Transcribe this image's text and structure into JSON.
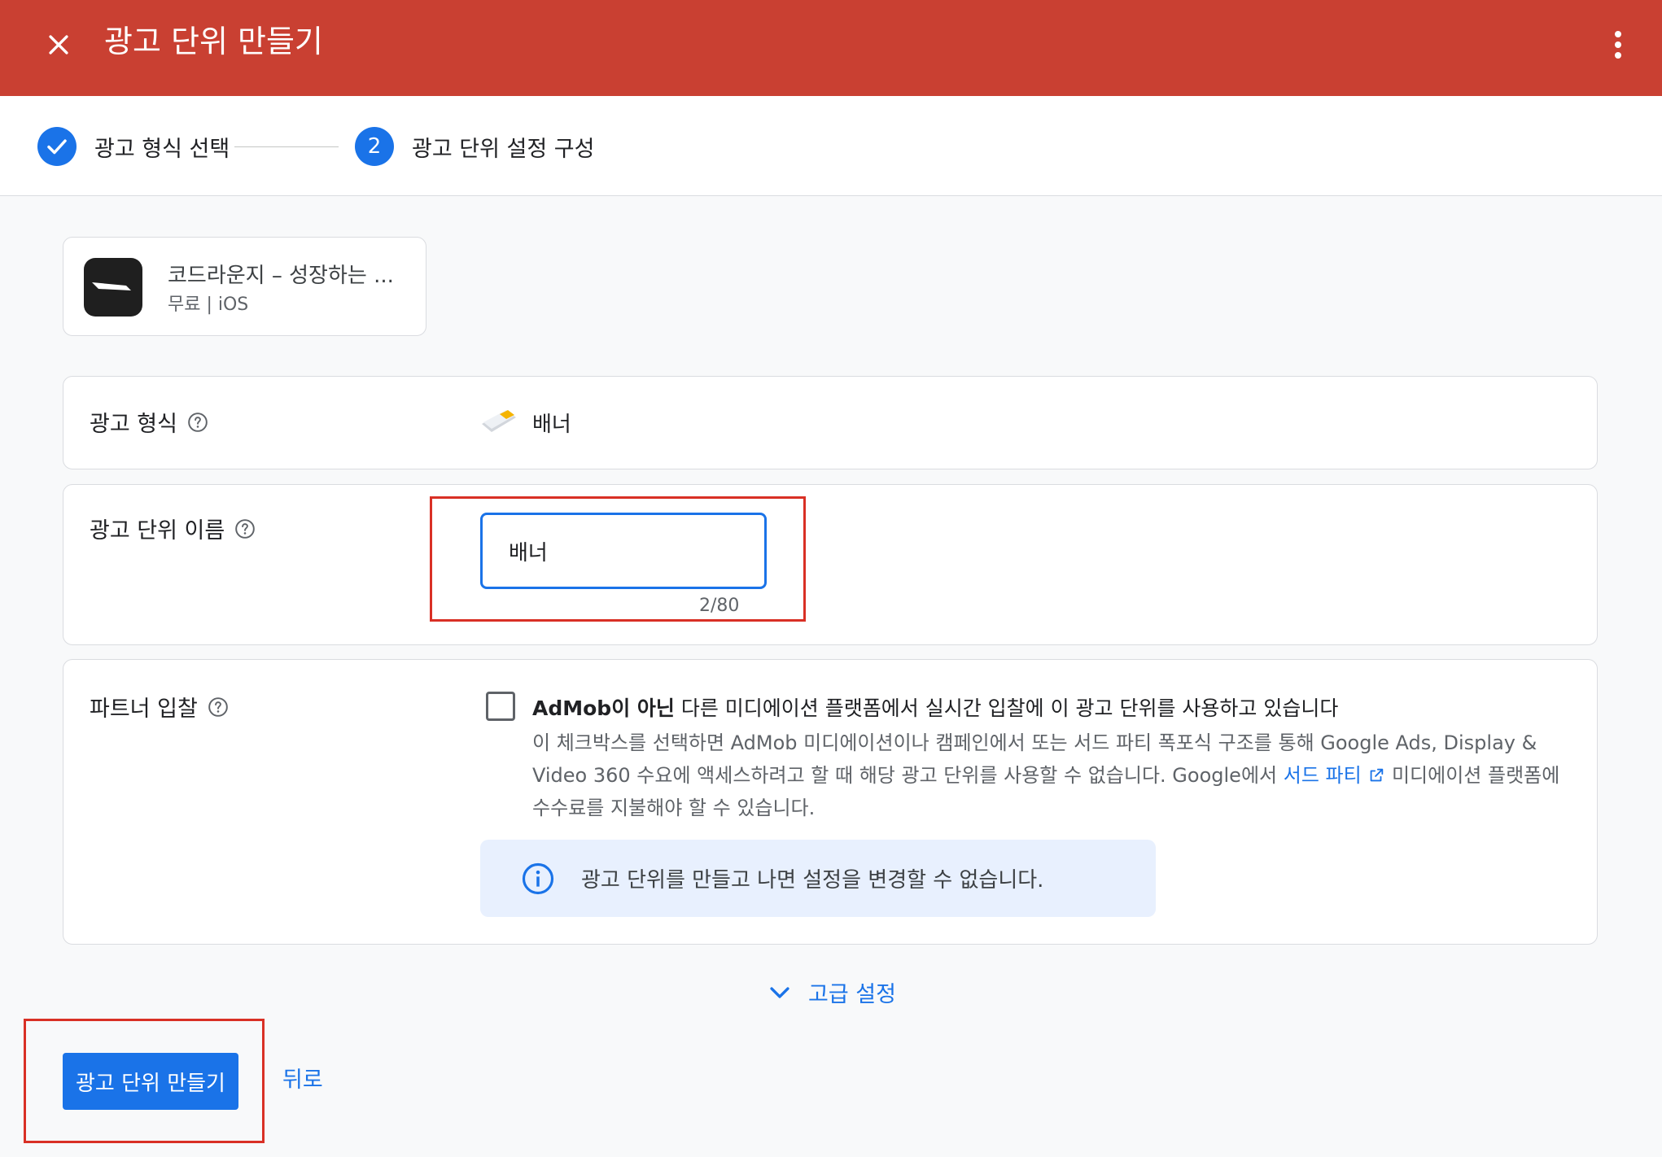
{
  "header": {
    "title": "광고 단위 만들기",
    "close_icon": "close-icon",
    "more_icon": "more-vert-icon",
    "color": "#c94032"
  },
  "stepper": {
    "steps": [
      {
        "label": "광고 형식 선택",
        "state": "done"
      },
      {
        "number": "2",
        "label": "광고 단위 설정 구성",
        "state": "active"
      }
    ]
  },
  "app": {
    "name": "코드라운지 – 성장하는 ...",
    "meta": "무료 | iOS"
  },
  "format_row": {
    "label": "광고 형식",
    "value": "배너"
  },
  "name_row": {
    "label": "광고 단위 이름",
    "value": "배너",
    "counter": "2/80"
  },
  "partner_row": {
    "label": "파트너 입찰",
    "checked": false,
    "title_bold": "AdMob이 아닌",
    "title_rest": " 다른 미디에이션 플랫폼에서 실시간 입찰에 이 광고 단위를 사용하고 있습니다",
    "desc_part1": "이 체크박스를 선택하면 AdMob 미디에이션이나 캠페인에서 또는 서드 파티 폭포식 구조를 통해 Google Ads, Display & Video 360 수요에 액세스하려고 할 때 해당 광고 단위를 사용할 수 없습니다. Google에서 ",
    "desc_link": "서드 파티",
    "desc_part2": " 미디에이션 플랫폼에 수수료를 지불해야 할 수 있습니다.",
    "info": "광고 단위를 만들고 나면 설정을 변경할 수 없습니다."
  },
  "advanced": {
    "label": "고급 설정"
  },
  "actions": {
    "create_label": "광고 단위 만들기",
    "back_label": "뒤로"
  },
  "colors": {
    "accent": "#1a73e8",
    "highlight": "#d93025"
  }
}
